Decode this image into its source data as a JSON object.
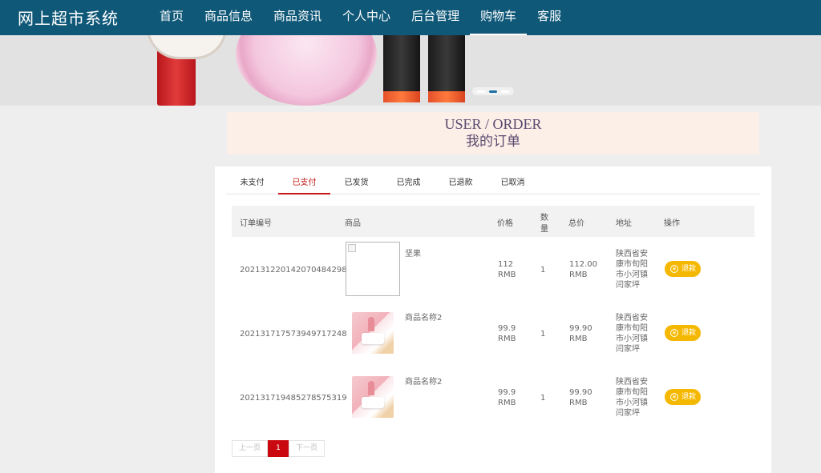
{
  "header": {
    "brand": "网上超市系统",
    "nav": [
      {
        "label": "首页",
        "active": false
      },
      {
        "label": "商品信息",
        "active": false
      },
      {
        "label": "商品资讯",
        "active": false
      },
      {
        "label": "个人中心",
        "active": false
      },
      {
        "label": "后台管理",
        "active": false
      },
      {
        "label": "购物车",
        "active": true
      },
      {
        "label": "客服",
        "active": false
      }
    ]
  },
  "banner": {
    "slides": 3,
    "current_slide": 2
  },
  "title": {
    "en": "USER / ORDER",
    "zh": "我的订单"
  },
  "tabs": [
    {
      "label": "未支付",
      "active": false
    },
    {
      "label": "已支付",
      "active": true
    },
    {
      "label": "已发货",
      "active": false
    },
    {
      "label": "已完成",
      "active": false
    },
    {
      "label": "已退款",
      "active": false
    },
    {
      "label": "已取消",
      "active": false
    }
  ],
  "table": {
    "headers": {
      "order_no": "订单编号",
      "product": "商品",
      "price": "价格",
      "qty_line1": "数",
      "qty_line2": "量",
      "total": "总价",
      "address": "地址",
      "action": "操作"
    },
    "rows": [
      {
        "order_no": "202131220142070484298",
        "product_name": "坚果",
        "image": "broken",
        "price_value": "112",
        "price_unit": "RMB",
        "qty": "1",
        "total_value": "112.00",
        "total_unit": "RMB",
        "address_lines": [
          "陕西省安",
          "康市旬阳",
          "市小河镇",
          "闫家坪"
        ],
        "action_label": "退款"
      },
      {
        "order_no": "20213171757394971724​8",
        "product_name": "商品名称2",
        "image": "thumb",
        "price_value": "99.9",
        "price_unit": "RMB",
        "qty": "1",
        "total_value": "99.90",
        "total_unit": "RMB",
        "address_lines": [
          "陕西省安",
          "康市旬阳",
          "市小河镇",
          "闫家坪"
        ],
        "action_label": "退款"
      },
      {
        "order_no": "202131719485278575319",
        "product_name": "商品名称2",
        "image": "thumb",
        "price_value": "99.9",
        "price_unit": "RMB",
        "qty": "1",
        "total_value": "99.90",
        "total_unit": "RMB",
        "address_lines": [
          "陕西省安",
          "康市旬阳",
          "市小河镇",
          "闫家坪"
        ],
        "action_label": "退款"
      }
    ]
  },
  "pagination": {
    "prev": "上一页",
    "current": "1",
    "next": "下一页"
  },
  "icons": {
    "refund": "yuan-coin-icon",
    "yuan_glyph": "¥"
  }
}
